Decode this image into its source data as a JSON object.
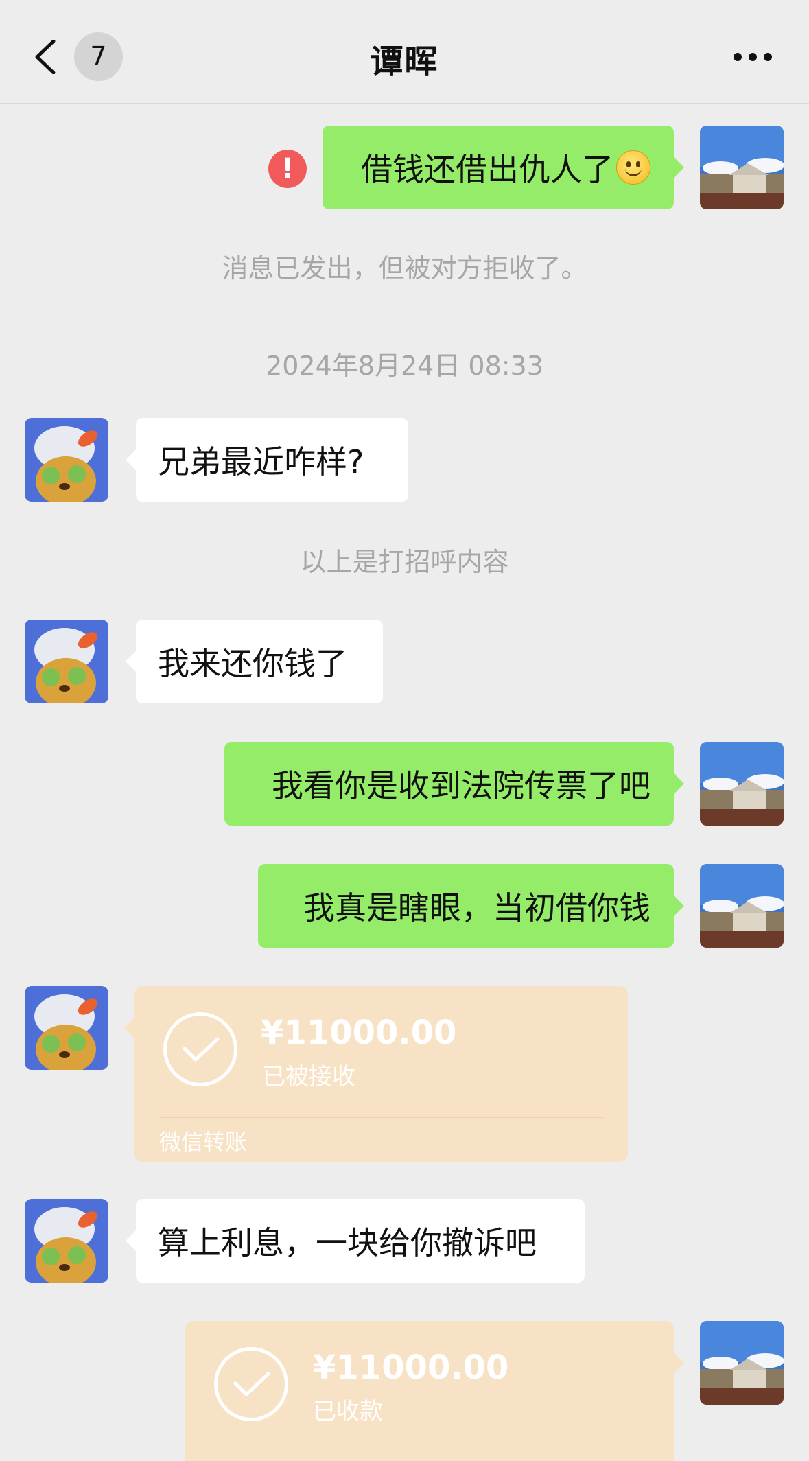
{
  "header": {
    "title": "谭晖",
    "unread_count": "7"
  },
  "messages": {
    "m1": "借钱还借出仇人了",
    "rejected_notice": "消息已发出，但被对方拒收了。",
    "timestamp": "2024年8月24日 08:33",
    "m2": "兄弟最近咋样?",
    "greeting_notice": "以上是打招呼内容",
    "m3": "我来还你钱了",
    "m4": "我看你是收到法院传票了吧",
    "m5": "我真是瞎眼，当初借你钱",
    "transfer1": {
      "amount": "¥11000.00",
      "status": "已被接收",
      "label": "微信转账"
    },
    "m6": "算上利息，一块给你撤诉吧",
    "transfer2": {
      "amount": "¥11000.00",
      "status": "已收款"
    }
  },
  "colors": {
    "outgoing_bubble": "#95ec69",
    "incoming_bubble": "#ffffff",
    "transfer_card": "#f7e2c6",
    "error_badge": "#f05a5a",
    "background": "#ededed"
  },
  "icons": [
    "back-arrow-icon",
    "more-icon",
    "error-icon",
    "check-circle-icon",
    "smile-emoji-icon"
  ]
}
